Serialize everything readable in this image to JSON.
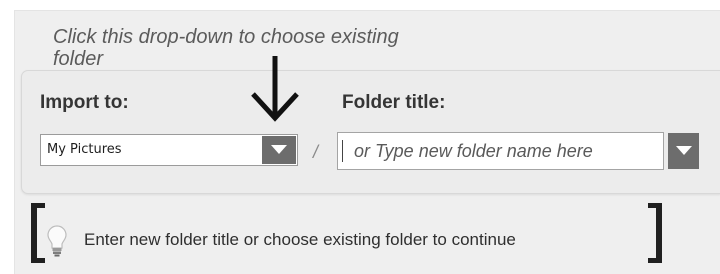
{
  "instruction": "Click this drop-down to choose existing folder",
  "import_to": {
    "label": "Import to:",
    "selected": "My Pictures"
  },
  "separator": "/",
  "folder_title": {
    "label": "Folder title:",
    "placeholder": "or Type new folder name here",
    "value": ""
  },
  "status": {
    "message": "Enter new folder title or choose existing folder to continue",
    "icon": "lightbulb-icon"
  },
  "icons": {
    "annotation_arrow": "arrow-down-icon",
    "dropdown": "chevron-down-icon"
  },
  "colors": {
    "panel_bg": "#efefef",
    "dropdown_button": "#6d6d6d",
    "label_text": "#353535",
    "bracket": "#202020"
  }
}
